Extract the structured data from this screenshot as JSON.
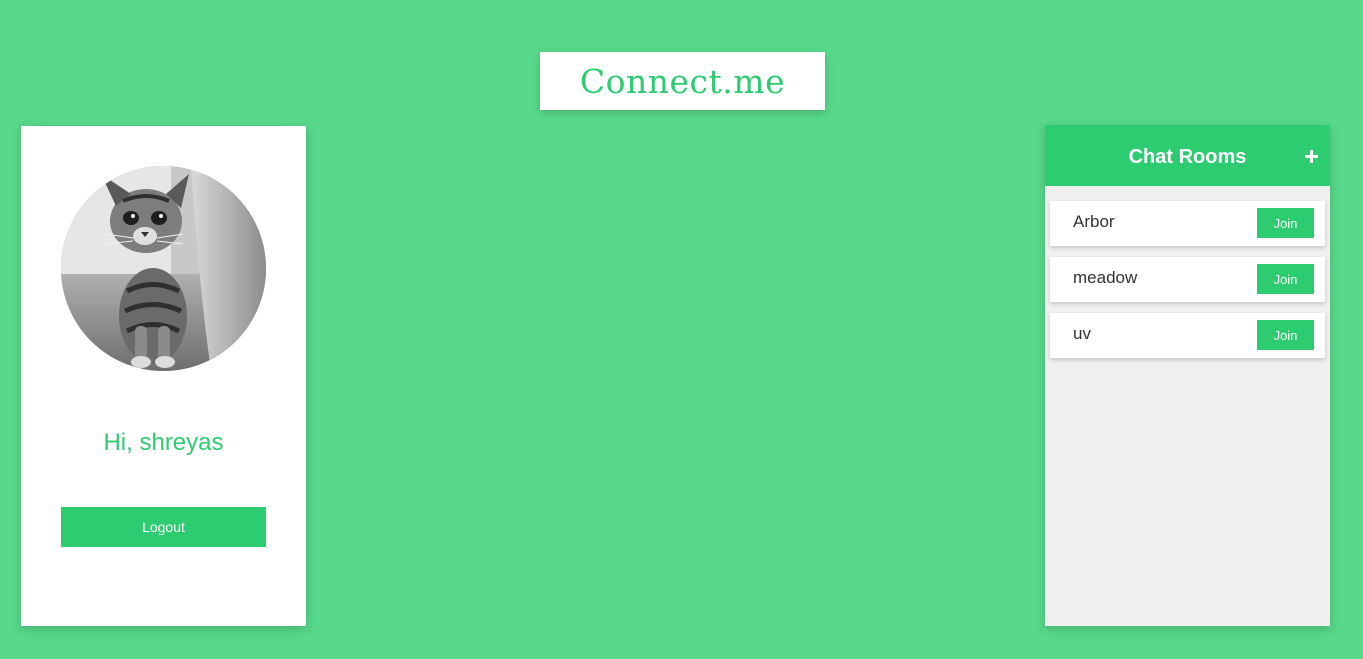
{
  "app": {
    "logo_text": "Connect.me",
    "accent_color": "#2ecc71",
    "background_color": "#57d88a"
  },
  "profile": {
    "avatar_icon": "kitten-avatar-photo",
    "greeting": "Hi, shreyas",
    "logout_label": "Logout"
  },
  "rooms": {
    "title": "Chat Rooms",
    "add_icon": "plus-icon",
    "items": [
      {
        "name": "Arbor",
        "join_label": "Join"
      },
      {
        "name": "meadow",
        "join_label": "Join"
      },
      {
        "name": "uv",
        "join_label": "Join"
      }
    ]
  }
}
